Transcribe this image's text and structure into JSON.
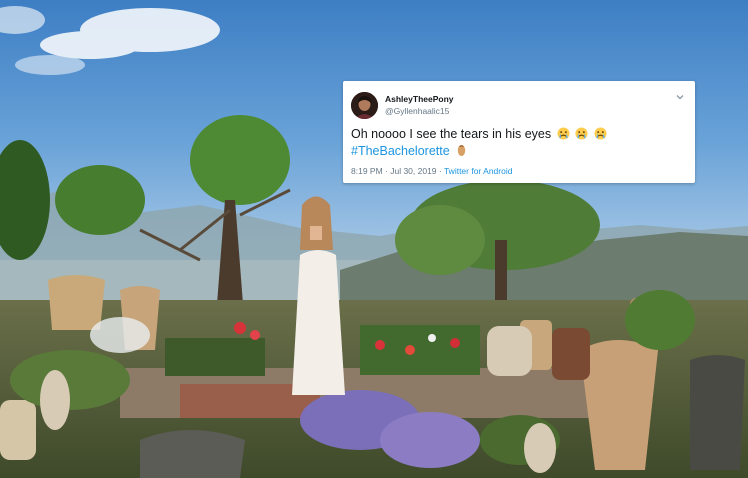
{
  "tweet": {
    "display_name": "AshleyTheePony",
    "handle": "@Gyllenhaalic15",
    "text": "Oh noooo I see the tears in his eyes",
    "emoji_icons": [
      "crying-face-emoji",
      "crying-face-emoji",
      "crying-face-emoji"
    ],
    "hashtag": "#TheBachelorette",
    "hashtag_emoji_icon": "rose-emoji",
    "time": "8:19 PM",
    "date": "Jul 30, 2019",
    "separator": " · ",
    "source": "Twitter for Android"
  },
  "colors": {
    "link": "#1b95e0",
    "text": "#14171a",
    "muted": "#657786"
  }
}
